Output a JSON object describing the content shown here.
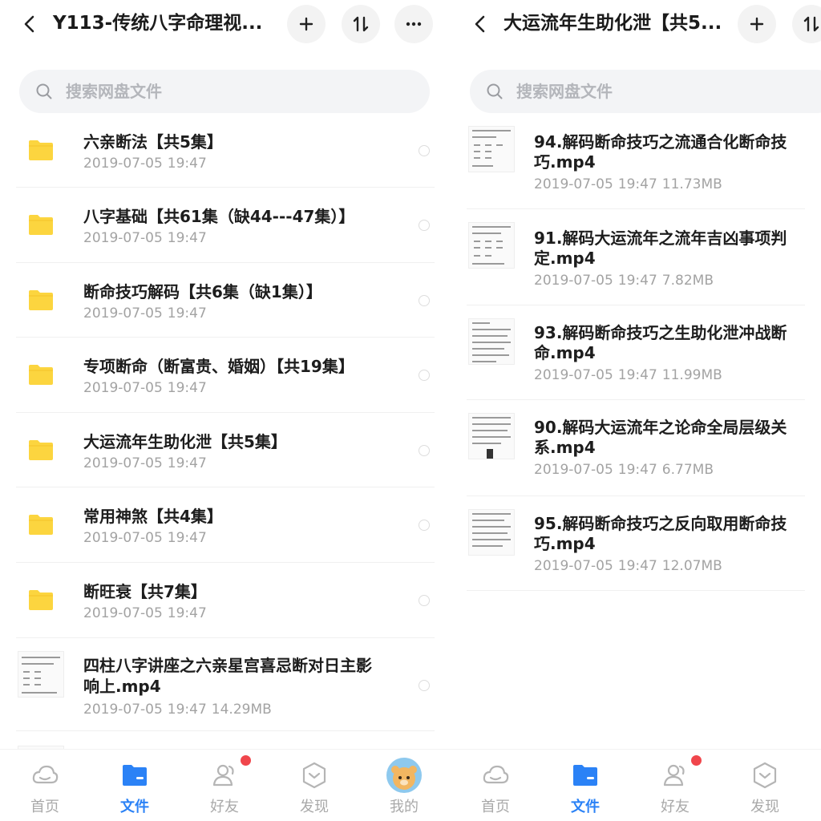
{
  "left": {
    "title": "Y113-传统八字命理视...",
    "search_placeholder": "搜索网盘文件",
    "items": [
      {
        "name": "六亲断法【共5集】",
        "date": "2019-07-05",
        "time": "19:47",
        "size": ""
      },
      {
        "name": "八字基础【共61集（缺44---47集）】",
        "date": "2019-07-05",
        "time": "19:47",
        "size": ""
      },
      {
        "name": "断命技巧解码【共6集（缺1集）】",
        "date": "2019-07-05",
        "time": "19:47",
        "size": ""
      },
      {
        "name": "专项断命（断富贵、婚姻）【共19集】",
        "date": "2019-07-05",
        "time": "19:47",
        "size": ""
      },
      {
        "name": "大运流年生助化泄【共5集】",
        "date": "2019-07-05",
        "time": "19:47",
        "size": ""
      },
      {
        "name": "常用神煞【共4集】",
        "date": "2019-07-05",
        "time": "19:47",
        "size": ""
      },
      {
        "name": "断旺衰【共7集】",
        "date": "2019-07-05",
        "time": "19:47",
        "size": ""
      },
      {
        "name_line1": "四柱八字讲座之六亲星宫喜忌断对日主影",
        "name_line2": "响上.mp4",
        "date": "2019-07-05",
        "time": "19:47",
        "size": "14.29MB"
      }
    ],
    "nav": [
      {
        "label": "首页",
        "icon": "cloud-home-icon"
      },
      {
        "label": "文件",
        "icon": "folder-files-icon"
      },
      {
        "label": "好友",
        "icon": "friends-icon"
      },
      {
        "label": "发现",
        "icon": "discover-icon"
      },
      {
        "label": "我的",
        "icon": "avatar-icon"
      }
    ]
  },
  "right": {
    "title": "大运流年生助化泄【共5...",
    "search_placeholder": "搜索网盘文件",
    "items": [
      {
        "name_line1": "94.解码断命技巧之流通合化断命技",
        "name_line2": "巧.mp4",
        "date": "2019-07-05",
        "time": "19:47",
        "size": "11.73MB"
      },
      {
        "name_line1": "91.解码大运流年之流年吉凶事项判",
        "name_line2": "定.mp4",
        "date": "2019-07-05",
        "time": "19:47",
        "size": "7.82MB"
      },
      {
        "name_line1": "93.解码断命技巧之生助化泄冲战断",
        "name_line2": "命.mp4",
        "date": "2019-07-05",
        "time": "19:47",
        "size": "11.99MB"
      },
      {
        "name_line1": "90.解码大运流年之论命全局层级关",
        "name_line2": "系.mp4",
        "date": "2019-07-05",
        "time": "19:47",
        "size": "6.77MB"
      },
      {
        "name_line1": "95.解码断命技巧之反向取用断命技",
        "name_line2": "巧.mp4",
        "date": "2019-07-05",
        "time": "19:47",
        "size": "12.07MB"
      }
    ],
    "nav": [
      {
        "label": "首页",
        "icon": "cloud-home-icon"
      },
      {
        "label": "文件",
        "icon": "folder-files-icon"
      },
      {
        "label": "好友",
        "icon": "friends-icon"
      },
      {
        "label": "发现",
        "icon": "discover-icon"
      }
    ]
  },
  "colors": {
    "accent": "#2b82f6",
    "folder": "#fcd53f",
    "badge": "#f0464c"
  }
}
